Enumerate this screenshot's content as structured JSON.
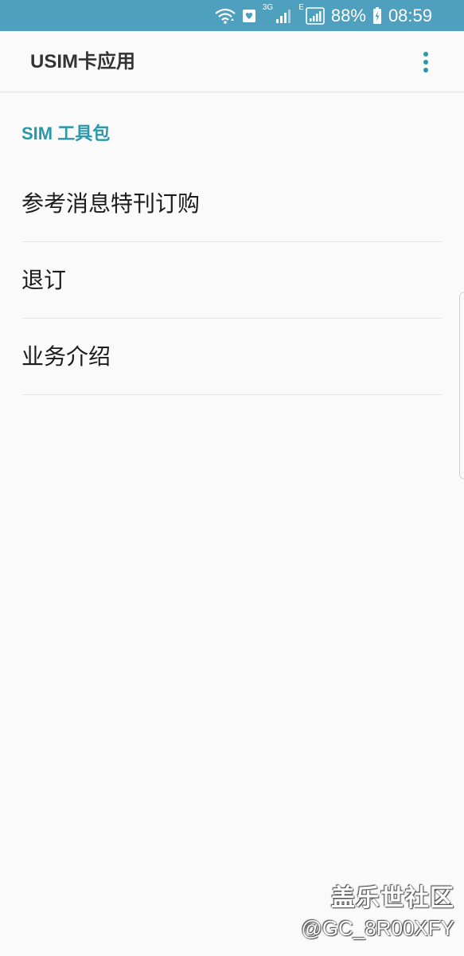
{
  "status_bar": {
    "network_3g": "3G",
    "network_e": "E",
    "battery": "88%",
    "time": "08:59",
    "icons": [
      "wifi-icon",
      "heart-notification-icon",
      "signal-icon",
      "signal-icon",
      "signal-box-icon",
      "battery-charging-icon"
    ],
    "color": "#4fa0bf"
  },
  "app_bar": {
    "title": "USIM卡应用",
    "more_icon": "more-vert-icon"
  },
  "section": {
    "title": "SIM 工具包",
    "accent": "#2a97aa"
  },
  "menu": {
    "items": [
      {
        "label": "参考消息特刊订购"
      },
      {
        "label": "退订"
      },
      {
        "label": "业务介绍"
      }
    ]
  },
  "watermark": {
    "line1": "盖乐世社区",
    "line2": "@GC_8R00XFY"
  }
}
